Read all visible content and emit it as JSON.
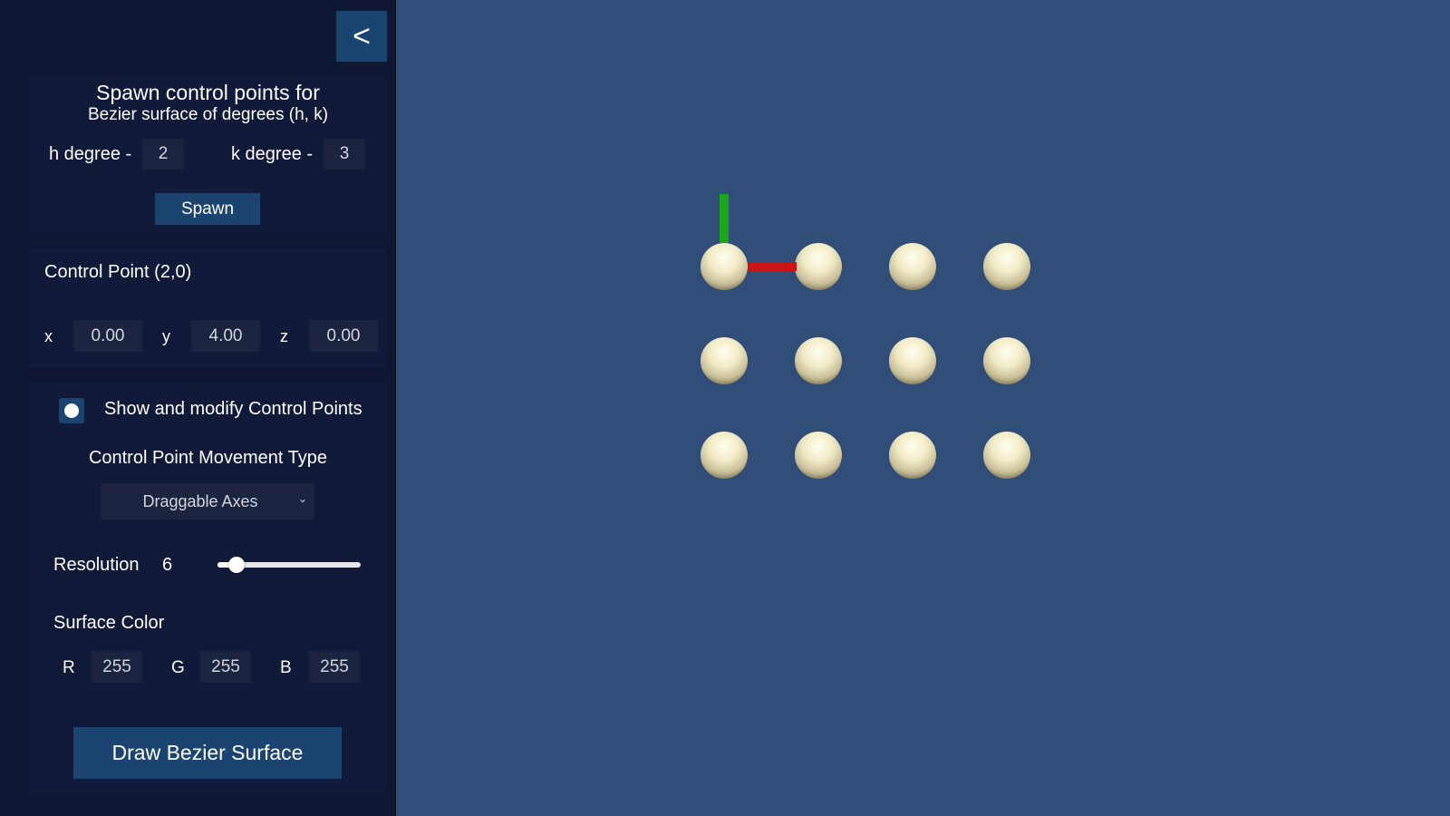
{
  "panel": {
    "collapse_label": "<",
    "spawn": {
      "title": "Spawn control points for",
      "subtitle": "Bezier surface of degrees (h, k)",
      "h_label": "h degree -",
      "h_value": "2",
      "k_label": "k degree -",
      "k_value": "3",
      "spawn_label": "Spawn"
    },
    "control_point": {
      "title": "Control Point (2,0)",
      "x_label": "x",
      "x_value": "0.00",
      "y_label": "y",
      "y_value": "4.00",
      "z_label": "z",
      "z_value": "0.00"
    },
    "options": {
      "show_label": "Show and modify Control Points",
      "show_checked": true,
      "movement_title": "Control Point Movement Type",
      "movement_value": "Draggable Axes",
      "resolution_label": "Resolution",
      "resolution_value": "6",
      "resolution_fraction": 0.13,
      "color_title": "Surface Color",
      "r_label": "R",
      "r_value": "255",
      "g_label": "G",
      "g_value": "255",
      "b_label": "B",
      "b_value": "255",
      "draw_label": "Draw Bezier Surface"
    }
  },
  "scene": {
    "background": "#314e78",
    "grid_rows": 3,
    "grid_cols": 4,
    "axis_y_color": "#1aa51a",
    "axis_x_color": "#cc1414"
  }
}
